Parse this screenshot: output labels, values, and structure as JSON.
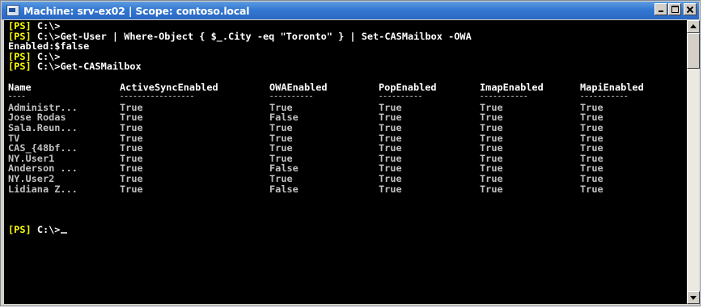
{
  "window": {
    "title": "Machine: srv-ex02 | Scope: contoso.local",
    "icon": "powershell-console-icon",
    "controls": [
      "minimize",
      "maximize",
      "close"
    ]
  },
  "console": {
    "prompt_tag": "[PS]",
    "prompt_path": "C:\\>",
    "command_1": "Get-User | Where-Object { $_.City -eq \"Toronto\" } | Set-CASMailbox -OWA",
    "command_1_wrap": "Enabled:$false",
    "command_2": "Get-CASMailbox",
    "table": {
      "headers": [
        "Name",
        "ActiveSyncEnabled",
        "OWAEnabled",
        "PopEnabled",
        "ImapEnabled",
        "MapiEnabled"
      ],
      "separators": [
        "----",
        "-----------------",
        "----------",
        "----------",
        "-----------",
        "-----------"
      ],
      "rows": [
        [
          "Administr...",
          "True",
          "True",
          "True",
          "True",
          "True"
        ],
        [
          "Jose Rodas",
          "True",
          "False",
          "True",
          "True",
          "True"
        ],
        [
          "Sala.Reun...",
          "True",
          "True",
          "True",
          "True",
          "True"
        ],
        [
          "TV",
          "True",
          "True",
          "True",
          "True",
          "True"
        ],
        [
          "CAS_{48bf...",
          "True",
          "True",
          "True",
          "True",
          "True"
        ],
        [
          "NY.User1",
          "True",
          "True",
          "True",
          "True",
          "True"
        ],
        [
          "Anderson ...",
          "True",
          "False",
          "True",
          "True",
          "True"
        ],
        [
          "NY.User2",
          "True",
          "True",
          "True",
          "True",
          "True"
        ],
        [
          "Lidiana Z...",
          "True",
          "False",
          "True",
          "True",
          "True"
        ]
      ]
    }
  },
  "colors": {
    "console_bg": "#000000",
    "console_text": "#c0c0c0",
    "prompt_tag": "#ffff00",
    "titlebar": "#3478d2"
  }
}
